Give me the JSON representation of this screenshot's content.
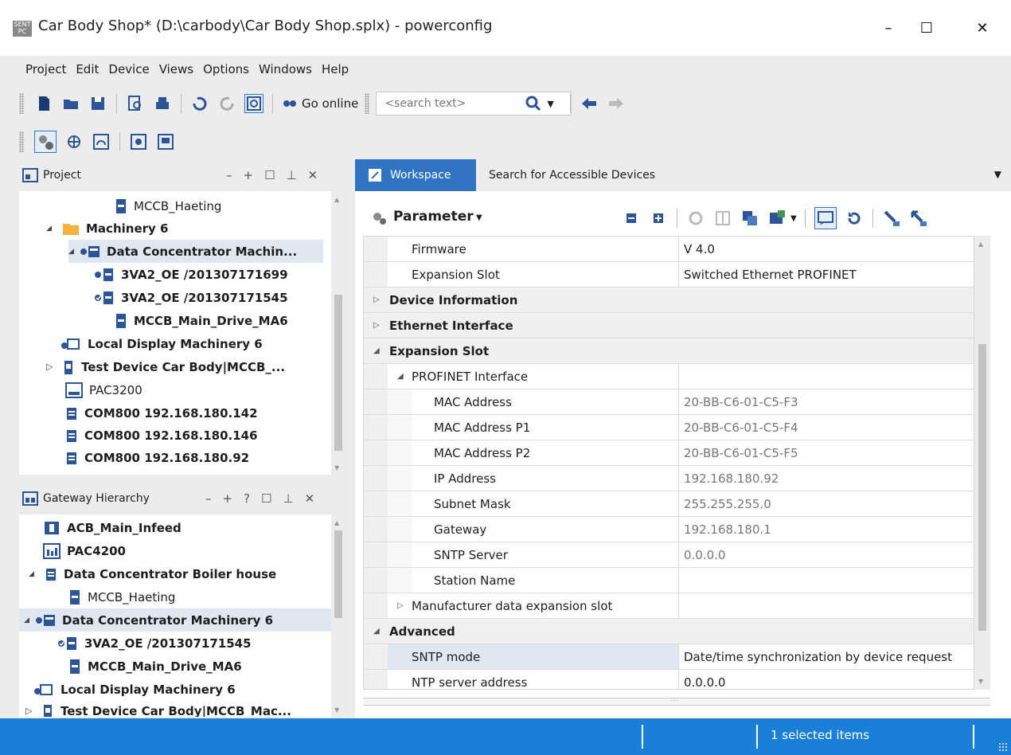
{
  "window": {
    "title": "Car Body Shop* (D:\\carbody\\Car Body Shop.splx) - powerconfig",
    "app_icon_text": "SENT PC",
    "minimize": "–",
    "maximize": "☐",
    "close": "✕"
  },
  "menu": [
    "Project",
    "Edit",
    "Device",
    "Views",
    "Options",
    "Windows",
    "Help"
  ],
  "toolbar": {
    "go_online": "Go online",
    "search_placeholder": "<search text>"
  },
  "project_panel": {
    "title": "Project",
    "controls": [
      "–",
      "+",
      "☐",
      "⊥",
      "✕"
    ],
    "items": [
      {
        "label": "MCCB_Haeting",
        "bold": false
      },
      {
        "label": "Machinery 6",
        "bold": true,
        "expander": "◢"
      },
      {
        "label": "Data Concentrator Machin...",
        "bold": true,
        "expander": "◢",
        "selected": true
      },
      {
        "label": "3VA2_OE /201307171699",
        "bold": true
      },
      {
        "label": "3VA2_OE /201307171545",
        "bold": true
      },
      {
        "label": "MCCB_Main_Drive_MA6",
        "bold": true
      },
      {
        "label": "Local Display Machinery 6",
        "bold": true
      },
      {
        "label": "Test Device Car Body|MCCB_...",
        "bold": true,
        "expander": "▷"
      },
      {
        "label": "PAC3200",
        "bold": false
      },
      {
        "label": "COM800 192.168.180.142",
        "bold": true
      },
      {
        "label": "COM800 192.168.180.146",
        "bold": true
      },
      {
        "label": "COM800 192.168.180.92",
        "bold": true
      }
    ]
  },
  "gateway_panel": {
    "title": "Gateway Hierarchy",
    "controls": [
      "–",
      "+",
      "?",
      "☐",
      "⊥",
      "✕"
    ],
    "items": [
      {
        "label": "ACB_Main_Infeed",
        "bold": true
      },
      {
        "label": "PAC4200",
        "bold": true
      },
      {
        "label": "Data Concentrator Boiler house",
        "bold": true,
        "expander": "◢"
      },
      {
        "label": "MCCB_Haeting",
        "bold": false
      },
      {
        "label": "Data Concentrator Machinery 6",
        "bold": true,
        "expander": "◢",
        "selected": true
      },
      {
        "label": "3VA2_OE /201307171545",
        "bold": true
      },
      {
        "label": "MCCB_Main_Drive_MA6",
        "bold": true
      },
      {
        "label": "Local Display Machinery 6",
        "bold": true
      },
      {
        "label": "Test Device Car Body|MCCB_Mac...",
        "bold": true,
        "expander": "▷"
      }
    ]
  },
  "tabs": {
    "workspace": "Workspace",
    "search": "Search for Accessible Devices"
  },
  "parameter": {
    "title": "Parameter",
    "rows": [
      {
        "key": "Firmware",
        "value": "V 4.0",
        "indent": 1
      },
      {
        "key": "Expansion Slot",
        "value": "Switched Ethernet PROFINET",
        "indent": 1
      },
      {
        "key": "Device Information",
        "value": "",
        "cat": true,
        "expander": "▷"
      },
      {
        "key": "Ethernet Interface",
        "value": "",
        "cat": true,
        "expander": "▷"
      },
      {
        "key": "Expansion Slot",
        "value": "",
        "cat": true,
        "expander": "◢"
      },
      {
        "key": "PROFINET Interface",
        "value": "",
        "indent": 1,
        "expander": "◢"
      },
      {
        "key": "MAC Address",
        "value": "20-BB-C6-01-C5-F3",
        "indent": 2,
        "gray": true
      },
      {
        "key": "MAC Address P1",
        "value": "20-BB-C6-01-C5-F4",
        "indent": 2,
        "gray": true
      },
      {
        "key": "MAC Address P2",
        "value": "20-BB-C6-01-C5-F5",
        "indent": 2,
        "gray": true
      },
      {
        "key": "IP Address",
        "value": "192.168.180.92",
        "indent": 2,
        "gray": true
      },
      {
        "key": "Subnet Mask",
        "value": "255.255.255.0",
        "indent": 2,
        "gray": true
      },
      {
        "key": "Gateway",
        "value": "192.168.180.1",
        "indent": 2,
        "gray": true
      },
      {
        "key": "SNTP Server",
        "value": "0.0.0.0",
        "indent": 2,
        "gray": true
      },
      {
        "key": "Station Name",
        "value": "",
        "indent": 2
      },
      {
        "key": "Manufacturer data expansion slot",
        "value": "",
        "indent": 1,
        "expander": "▷"
      },
      {
        "key": "Advanced",
        "value": "",
        "cat": true,
        "expander": "◢"
      },
      {
        "key": "SNTP mode",
        "value": "Date/time synchronization by device request",
        "indent": 1,
        "selected": true
      },
      {
        "key": "NTP server address",
        "value": "0.0.0.0",
        "indent": 1
      }
    ]
  },
  "status": {
    "selected": "1 selected items"
  },
  "colors": {
    "accent": "#2f74c5",
    "status_bar": "#1a7fd6",
    "selection": "#dfe8f2"
  }
}
